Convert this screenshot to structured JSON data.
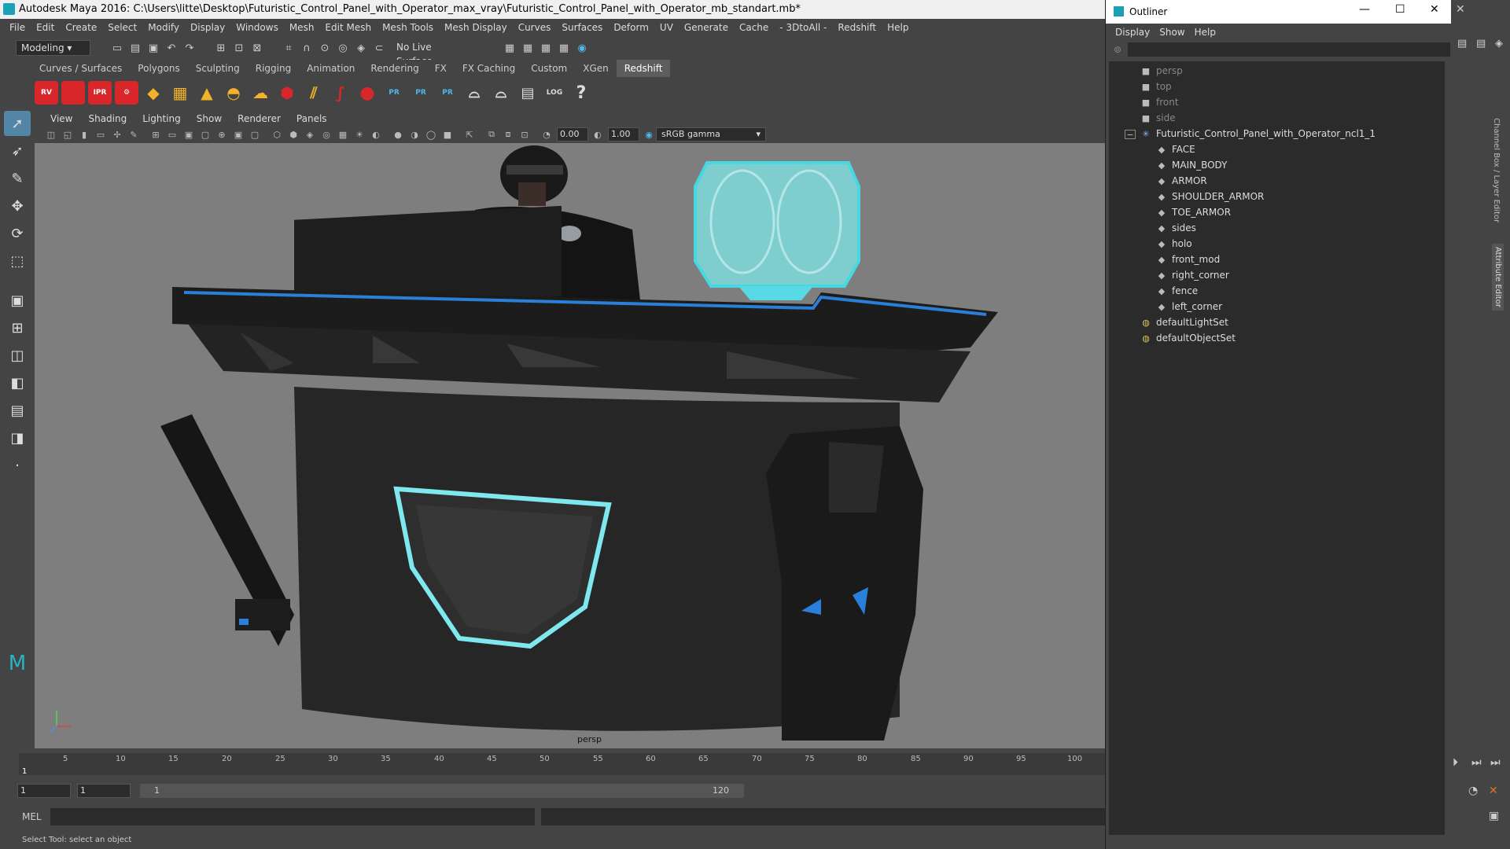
{
  "titlebar": {
    "title": "Autodesk Maya 2016: C:\\Users\\litte\\Desktop\\Futuristic_Control_Panel_with_Operator_max_vray\\Futuristic_Control_Panel_with_Operator_mb_standart.mb*"
  },
  "menu": [
    "File",
    "Edit",
    "Create",
    "Select",
    "Modify",
    "Display",
    "Windows",
    "Mesh",
    "Edit Mesh",
    "Mesh Tools",
    "Mesh Display",
    "Curves",
    "Surfaces",
    "Deform",
    "UV",
    "Generate",
    "Cache",
    "- 3DtoAll -",
    "Redshift",
    "Help"
  ],
  "status": {
    "mode": "Modeling",
    "live_surface": "No Live Surface"
  },
  "shelf_tabs": [
    "Curves / Surfaces",
    "Polygons",
    "Sculpting",
    "Rigging",
    "Animation",
    "Rendering",
    "FX",
    "FX Caching",
    "Custom",
    "XGen",
    "Redshift"
  ],
  "shelf_active": "Redshift",
  "shelf_labels": {
    "rv": "RV",
    "ipr": "IPR",
    "pr": "PR",
    "log": "LOG",
    "help": "?"
  },
  "viewport": {
    "menu": [
      "View",
      "Shading",
      "Lighting",
      "Show",
      "Renderer",
      "Panels"
    ],
    "exposure": "0.00",
    "gamma": "1.00",
    "colorspace": "sRGB gamma",
    "camera_label": "persp"
  },
  "timeline": {
    "ticks": [
      "1",
      "5",
      "10",
      "15",
      "20",
      "25",
      "30",
      "35",
      "40",
      "45",
      "50",
      "55",
      "60",
      "65",
      "70",
      "75",
      "80",
      "85",
      "90",
      "95",
      "100"
    ],
    "current_frame": "1"
  },
  "range": {
    "start": "1",
    "playback_start": "1",
    "range_start": "1",
    "range_end": "120"
  },
  "cmd": {
    "label": "MEL"
  },
  "help": {
    "text": "Select Tool: select an object"
  },
  "outliner": {
    "title": "Outliner",
    "menu": [
      "Display",
      "Show",
      "Help"
    ],
    "cameras": [
      "persp",
      "top",
      "front",
      "side"
    ],
    "group": "Futuristic_Control_Panel_with_Operator_ncl1_1",
    "children": [
      "FACE",
      "MAIN_BODY",
      "ARMOR",
      "SHOULDER_ARMOR",
      "TOE_ARMOR",
      "sides",
      "holo",
      "front_mod",
      "right_corner",
      "fence",
      "left_corner"
    ],
    "sets": [
      "defaultLightSet",
      "defaultObjectSet"
    ]
  },
  "side_tabs": {
    "channel_box": "Channel Box / Layer Editor",
    "attribute_editor": "Attribute Editor"
  }
}
